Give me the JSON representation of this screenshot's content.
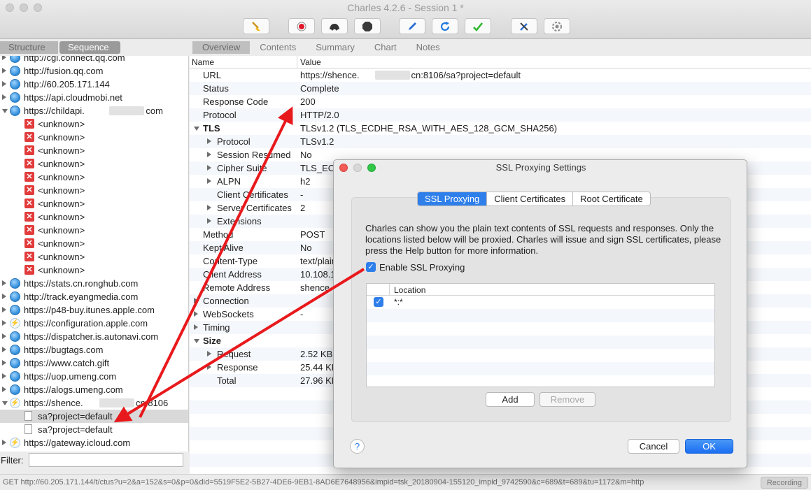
{
  "window": {
    "title": "Charles 4.2.6 - Session 1 *"
  },
  "toolbar": {
    "icons": [
      "broom-icon",
      "record-icon",
      "throttle-icon",
      "breakpoints-icon",
      "compose-icon",
      "repeat-icon",
      "validate-icon",
      "tools-icon",
      "settings-icon"
    ]
  },
  "left_tabs": [
    "Structure",
    "Sequence"
  ],
  "right_tabs": [
    "Overview",
    "Contents",
    "Summary",
    "Chart",
    "Notes"
  ],
  "tree": [
    {
      "label": "http://cgi.connect.qq.com",
      "icon": "globe",
      "indent": 0,
      "expander": "right"
    },
    {
      "label": "http://fusion.qq.com",
      "icon": "globe",
      "indent": 0,
      "expander": "right"
    },
    {
      "label": "http://60.205.171.144",
      "icon": "globe",
      "indent": 0,
      "expander": "right"
    },
    {
      "label": "https://api.cloudmobi.net",
      "icon": "globe",
      "indent": 0,
      "expander": "right"
    },
    {
      "label": "https://childapi.",
      "suffix": "com",
      "icon": "globe",
      "indent": 0,
      "expander": "down",
      "redacted": true
    },
    {
      "label": "<unknown>",
      "icon": "x",
      "indent": 1
    },
    {
      "label": "<unknown>",
      "icon": "x",
      "indent": 1
    },
    {
      "label": "<unknown>",
      "icon": "x",
      "indent": 1
    },
    {
      "label": "<unknown>",
      "icon": "x",
      "indent": 1
    },
    {
      "label": "<unknown>",
      "icon": "x",
      "indent": 1
    },
    {
      "label": "<unknown>",
      "icon": "x",
      "indent": 1
    },
    {
      "label": "<unknown>",
      "icon": "x",
      "indent": 1
    },
    {
      "label": "<unknown>",
      "icon": "x",
      "indent": 1
    },
    {
      "label": "<unknown>",
      "icon": "x",
      "indent": 1
    },
    {
      "label": "<unknown>",
      "icon": "x",
      "indent": 1
    },
    {
      "label": "<unknown>",
      "icon": "x",
      "indent": 1
    },
    {
      "label": "<unknown>",
      "icon": "x",
      "indent": 1
    },
    {
      "label": "https://stats.cn.ronghub.com",
      "icon": "globe",
      "indent": 0,
      "expander": "right"
    },
    {
      "label": "http://track.eyangmedia.com",
      "icon": "globe",
      "indent": 0,
      "expander": "right"
    },
    {
      "label": "https://p48-buy.itunes.apple.com",
      "icon": "globe",
      "indent": 0,
      "expander": "right"
    },
    {
      "label": "https://configuration.apple.com",
      "icon": "bolt",
      "indent": 0,
      "expander": "right"
    },
    {
      "label": "https://dispatcher.is.autonavi.com",
      "icon": "globe",
      "indent": 0,
      "expander": "right"
    },
    {
      "label": "https://bugtags.com",
      "icon": "globe",
      "indent": 0,
      "expander": "right"
    },
    {
      "label": "https://www.catch.gift",
      "icon": "globe",
      "indent": 0,
      "expander": "right"
    },
    {
      "label": "https://uop.umeng.com",
      "icon": "globe",
      "indent": 0,
      "expander": "right"
    },
    {
      "label": "https://alogs.umeng.com",
      "icon": "globe",
      "indent": 0,
      "expander": "right"
    },
    {
      "label": "https://shence.",
      "suffix": "cn:8106",
      "icon": "bolt",
      "indent": 0,
      "expander": "down",
      "redacted": true
    },
    {
      "label": "sa?project=default",
      "icon": "doc",
      "indent": 1,
      "selected": true
    },
    {
      "label": "sa?project=default",
      "icon": "doc",
      "indent": 1
    },
    {
      "label": "https://gateway.icloud.com",
      "icon": "bolt",
      "indent": 0,
      "expander": "right"
    }
  ],
  "filter": {
    "label": "Filter:",
    "value": ""
  },
  "grid": {
    "headers": [
      "Name",
      "Value"
    ],
    "rows": [
      {
        "name": "URL",
        "value": "https://shence.",
        "value_suffix": "cn:8106/sa?project=default",
        "level": 0
      },
      {
        "name": "Status",
        "value": "Complete",
        "level": 0
      },
      {
        "name": "Response Code",
        "value": "200",
        "level": 0
      },
      {
        "name": "Protocol",
        "value": "HTTP/2.0",
        "level": 0
      },
      {
        "name": "TLS",
        "value": "TLSv1.2 (TLS_ECDHE_RSA_WITH_AES_128_GCM_SHA256)",
        "level": 0,
        "bold": true,
        "expander": "down"
      },
      {
        "name": "Protocol",
        "value": "TLSv1.2",
        "level": 1,
        "expander": "right"
      },
      {
        "name": "Session Resumed",
        "value": "No",
        "level": 1,
        "expander": "right"
      },
      {
        "name": "Cipher Suite",
        "value": "TLS_ECDHE_RSA_WITH_AES_128_GCM_SHA256",
        "level": 1,
        "expander": "right"
      },
      {
        "name": "ALPN",
        "value": "h2",
        "level": 1,
        "expander": "right"
      },
      {
        "name": "Client Certificates",
        "value": "-",
        "level": 1
      },
      {
        "name": "Server Certificates",
        "value": "2",
        "level": 1,
        "expander": "right"
      },
      {
        "name": "Extensions",
        "value": "",
        "level": 1,
        "expander": "right"
      },
      {
        "name": "Method",
        "value": "POST",
        "level": 0
      },
      {
        "name": "Kept Alive",
        "value": "No",
        "level": 0
      },
      {
        "name": "Content-Type",
        "value": "text/plain",
        "level": 0
      },
      {
        "name": "Client Address",
        "value": "10.108.1",
        "level": 0
      },
      {
        "name": "Remote Address",
        "value": "shence",
        "level": 0
      },
      {
        "name": "Connection",
        "value": "",
        "level": 0,
        "expander": "right",
        "indent_tri": true
      },
      {
        "name": "WebSockets",
        "value": "-",
        "level": 0,
        "expander": "right",
        "indent_tri": true
      },
      {
        "name": "Timing",
        "value": "",
        "level": 0,
        "expander": "right",
        "indent_tri": true
      },
      {
        "name": "Size",
        "value": "",
        "level": 0,
        "bold": true,
        "expander": "down"
      },
      {
        "name": "Request",
        "value": "2.52 KB",
        "level": 1,
        "expander": "right"
      },
      {
        "name": "Response",
        "value": "25.44 KB",
        "level": 1,
        "expander": "right"
      },
      {
        "name": "Total",
        "value": "27.96 KB",
        "level": 1
      }
    ]
  },
  "status": {
    "text": "GET http://60.205.171.144/t/ctus?u=2&a=152&s=0&p=0&did=5519F5E2-5B27-4DE6-9EB1-8AD6E7648956&impid=tsk_20180904-155120_impid_9742590&c=689&t=689&tu=1172&m=http",
    "recording_label": "Recording"
  },
  "dialog": {
    "title": "SSL Proxying Settings",
    "tabs": [
      "SSL Proxying",
      "Client Certificates",
      "Root Certificate"
    ],
    "active_tab": "SSL Proxying",
    "description": "Charles can show you the plain text contents of SSL requests and responses. Only the locations listed below will be proxied. Charles will issue and sign SSL certificates, please press the Help button for more information.",
    "enable_label": "Enable SSL Proxying",
    "enable_checked": true,
    "table_header": "Location",
    "locations": [
      {
        "checked": true,
        "location": "*:*"
      }
    ],
    "add_label": "Add",
    "remove_label": "Remove",
    "help_label": "?",
    "cancel_label": "Cancel",
    "ok_label": "OK"
  },
  "colors": {
    "accent": "#2f7fea",
    "arrow": "#e8191c",
    "error": "#e23b3b",
    "close": "#f25b55",
    "minimize": "#d8d8d8",
    "zoom": "#33c748"
  }
}
